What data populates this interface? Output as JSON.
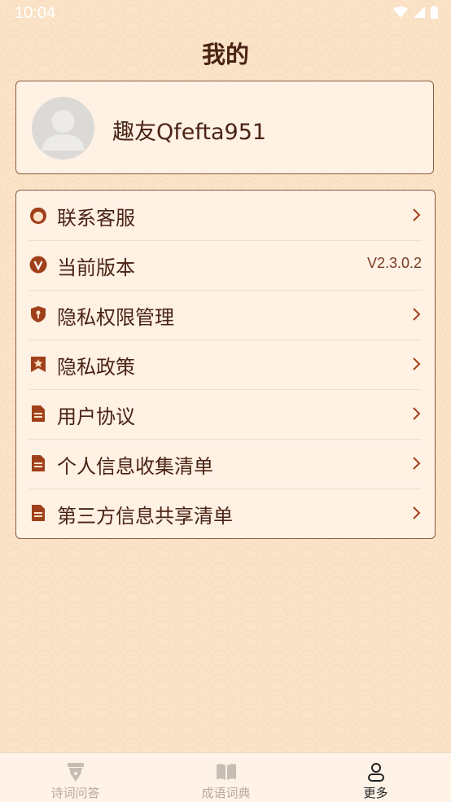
{
  "status_bar": {
    "time": "10:04"
  },
  "page_title": "我的",
  "profile": {
    "username": "趣友Qfefta951"
  },
  "menu": {
    "items": [
      {
        "label": "联系客服",
        "icon": "customer-service-icon",
        "value": ""
      },
      {
        "label": "当前版本",
        "icon": "version-icon",
        "value": "V2.3.0.2"
      },
      {
        "label": "隐私权限管理",
        "icon": "privacy-shield-icon",
        "value": ""
      },
      {
        "label": "隐私政策",
        "icon": "bookmark-star-icon",
        "value": ""
      },
      {
        "label": "用户协议",
        "icon": "document-icon",
        "value": ""
      },
      {
        "label": "个人信息收集清单",
        "icon": "document-icon",
        "value": ""
      },
      {
        "label": "第三方信息共享清单",
        "icon": "document-icon",
        "value": ""
      }
    ]
  },
  "tabs": [
    {
      "label": "诗词问答",
      "icon": "pen-nib-icon",
      "active": false
    },
    {
      "label": "成语词典",
      "icon": "book-icon",
      "active": false
    },
    {
      "label": "更多",
      "icon": "person-icon",
      "active": true
    }
  ],
  "colors": {
    "accent": "#a0401a",
    "text": "#4a2314",
    "background": "#fbe3c8"
  }
}
